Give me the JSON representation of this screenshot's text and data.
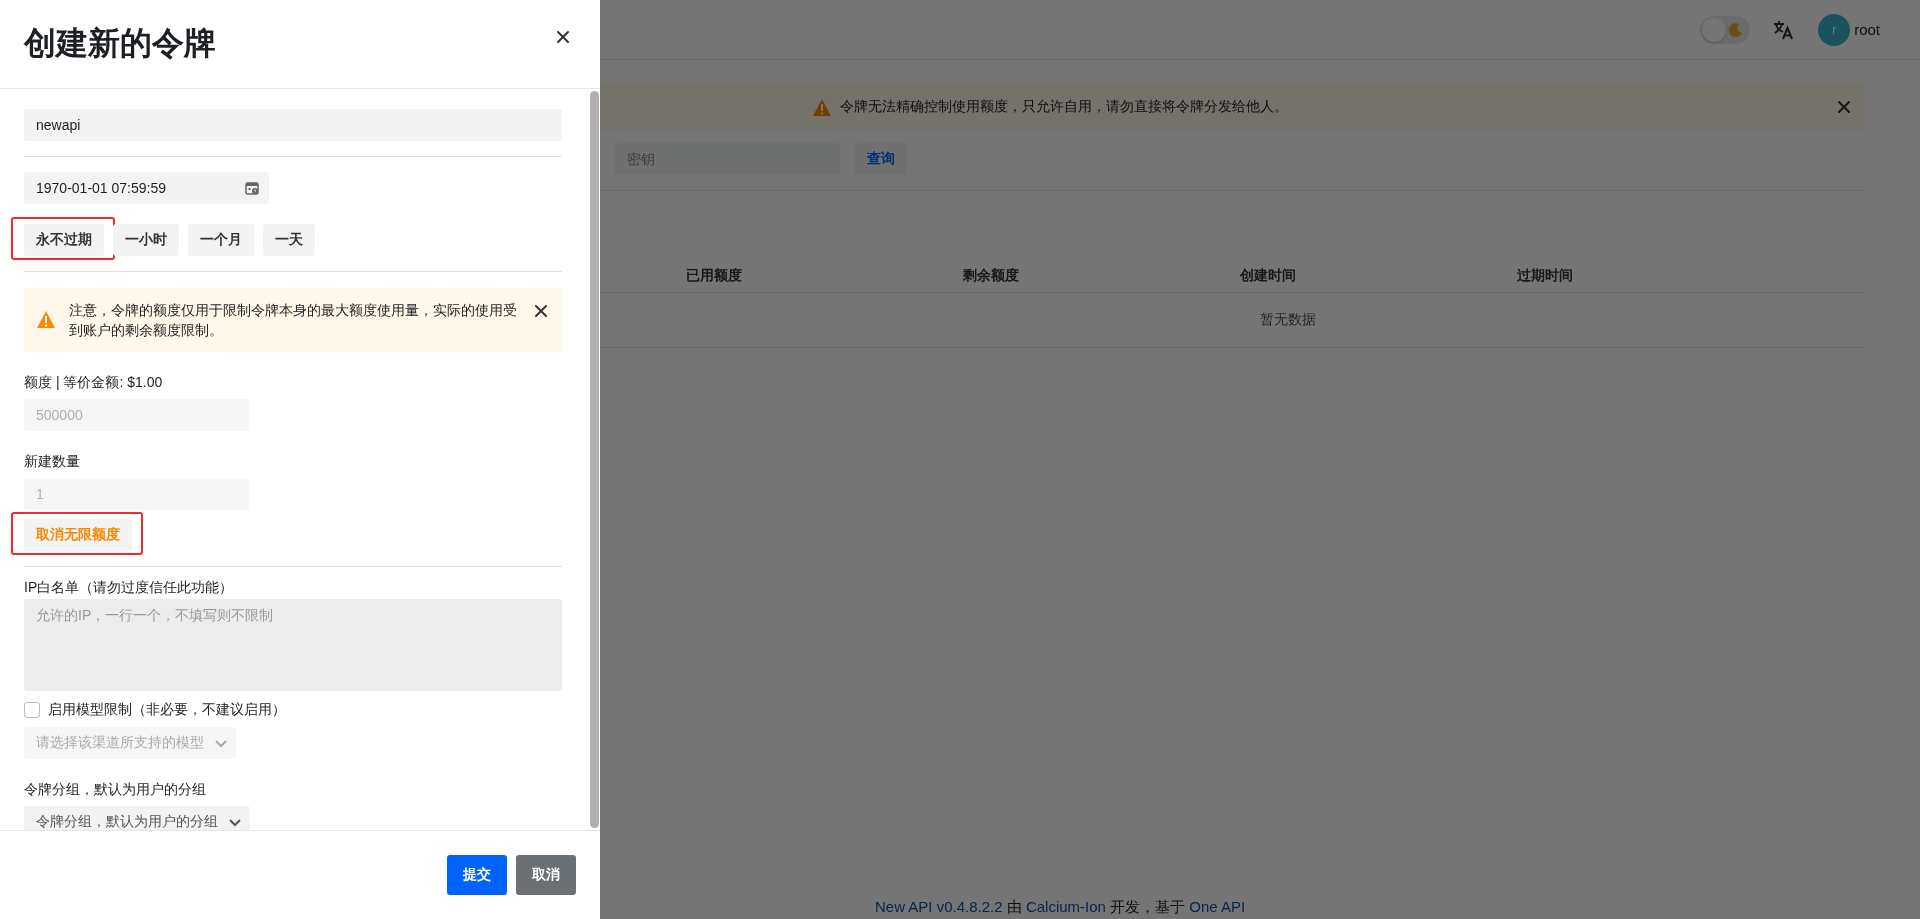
{
  "drawer": {
    "title": "创建新的令牌",
    "name_field": {
      "value": "newapi"
    },
    "expiry_field": {
      "value": "1970-01-01 07:59:59"
    },
    "expiry_presets": [
      {
        "label": "永不过期",
        "highlighted": true
      },
      {
        "label": "一小时",
        "highlighted": false
      },
      {
        "label": "一个月",
        "highlighted": false
      },
      {
        "label": "一天",
        "highlighted": false
      }
    ],
    "notice": {
      "text": "注意，令牌的额度仅用于限制令牌本身的最大额度使用量，实际的使用受到账户的剩余额度限制。"
    },
    "quota": {
      "label": "额度 | 等价金额: $1.00",
      "placeholder": "500000"
    },
    "count": {
      "label": "新建数量",
      "placeholder": "1"
    },
    "unlimited_button": {
      "label": "取消无限额度",
      "highlighted": true
    },
    "ip_whitelist": {
      "label": "IP白名单（请勿过度信任此功能）",
      "placeholder": "允许的IP，一行一个，不填写则不限制"
    },
    "model_limit": {
      "label": "启用模型限制（非必要，不建议启用）",
      "checked": false
    },
    "model_select": {
      "placeholder": "请选择该渠道所支持的模型",
      "disabled": true
    },
    "group": {
      "label": "令牌分组，默认为用户的分组",
      "placeholder": "令牌分组，默认为用户的分组"
    },
    "buttons": [
      {
        "label": "提交",
        "kind": "primary"
      },
      {
        "label": "取消",
        "kind": "secondary"
      }
    ]
  },
  "page": {
    "theme_toggle": {
      "on": false
    },
    "user": {
      "avatar": "r",
      "name": "root"
    },
    "banner": {
      "text": "令牌无法精确控制使用额度，只允许自用，请勿直接将令牌分发给他人。"
    },
    "search": {
      "placeholder": "密钥"
    },
    "query_button": "查询",
    "table": {
      "columns": [
        "已用额度",
        "剩余额度",
        "创建时间",
        "过期时间"
      ],
      "empty_text": "暂无数据"
    },
    "footer": [
      {
        "text": "New API v0.4.8.2.2",
        "link": true
      },
      {
        "text": " 由 ",
        "link": false
      },
      {
        "text": "Calcium-Ion",
        "link": true
      },
      {
        "text": " 开发，基于 ",
        "link": false
      },
      {
        "text": "One API",
        "link": true
      }
    ]
  }
}
